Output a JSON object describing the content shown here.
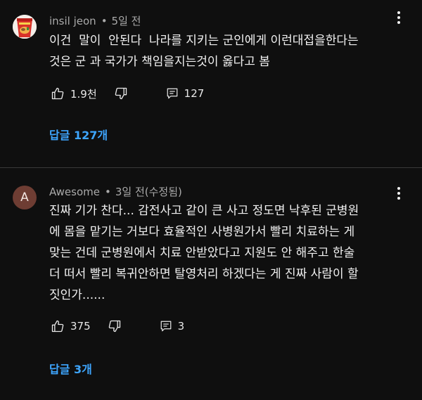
{
  "comments": [
    {
      "author": "insil jeon",
      "separator": "•",
      "time": "5일 전",
      "body": "이건  말이  안된다  나라를 지키는 군인에게 이런대접을한다는\n것은 군 과 국가가 책임을지는것이 옳다고 봄",
      "likes": "1.9천",
      "replies_count": "127",
      "replies_button": "답글 127개",
      "avatar_icon": "ramen-cup-avatar",
      "like_icon": "thumbs-up-icon",
      "dislike_icon": "thumbs-down-icon",
      "reply_icon": "comment-icon",
      "more_icon": "more-vertical-icon"
    },
    {
      "author": "Awesome",
      "separator": "•",
      "time": "3일 전(수정됨)",
      "avatar_letter": "A",
      "avatar_color": "#6e3d33",
      "body": "진짜 기가 찬다... 감전사고 같이 큰 사고 정도면 낙후된 군병원\n에 몸을 맡기는 거보다 효율적인 사병원가서 빨리 치료하는 게\n맞는 건데 군병원에서 치료 안받았다고 지원도 안 해주고 한술\n더 떠서 빨리 복귀안하면 탈영처리 하겠다는 게 진짜 사람이 할\n짓인가......",
      "likes": "375",
      "replies_count": "3",
      "replies_button": "답글 3개",
      "like_icon": "thumbs-up-icon",
      "dislike_icon": "thumbs-down-icon",
      "reply_icon": "comment-icon",
      "more_icon": "more-vertical-icon"
    }
  ],
  "colors": {
    "background": "#0f0f0f",
    "text_primary": "#f1f1f1",
    "text_secondary": "#aaaaaa",
    "link_blue": "#3ea6ff",
    "divider": "#3a3a3a"
  }
}
